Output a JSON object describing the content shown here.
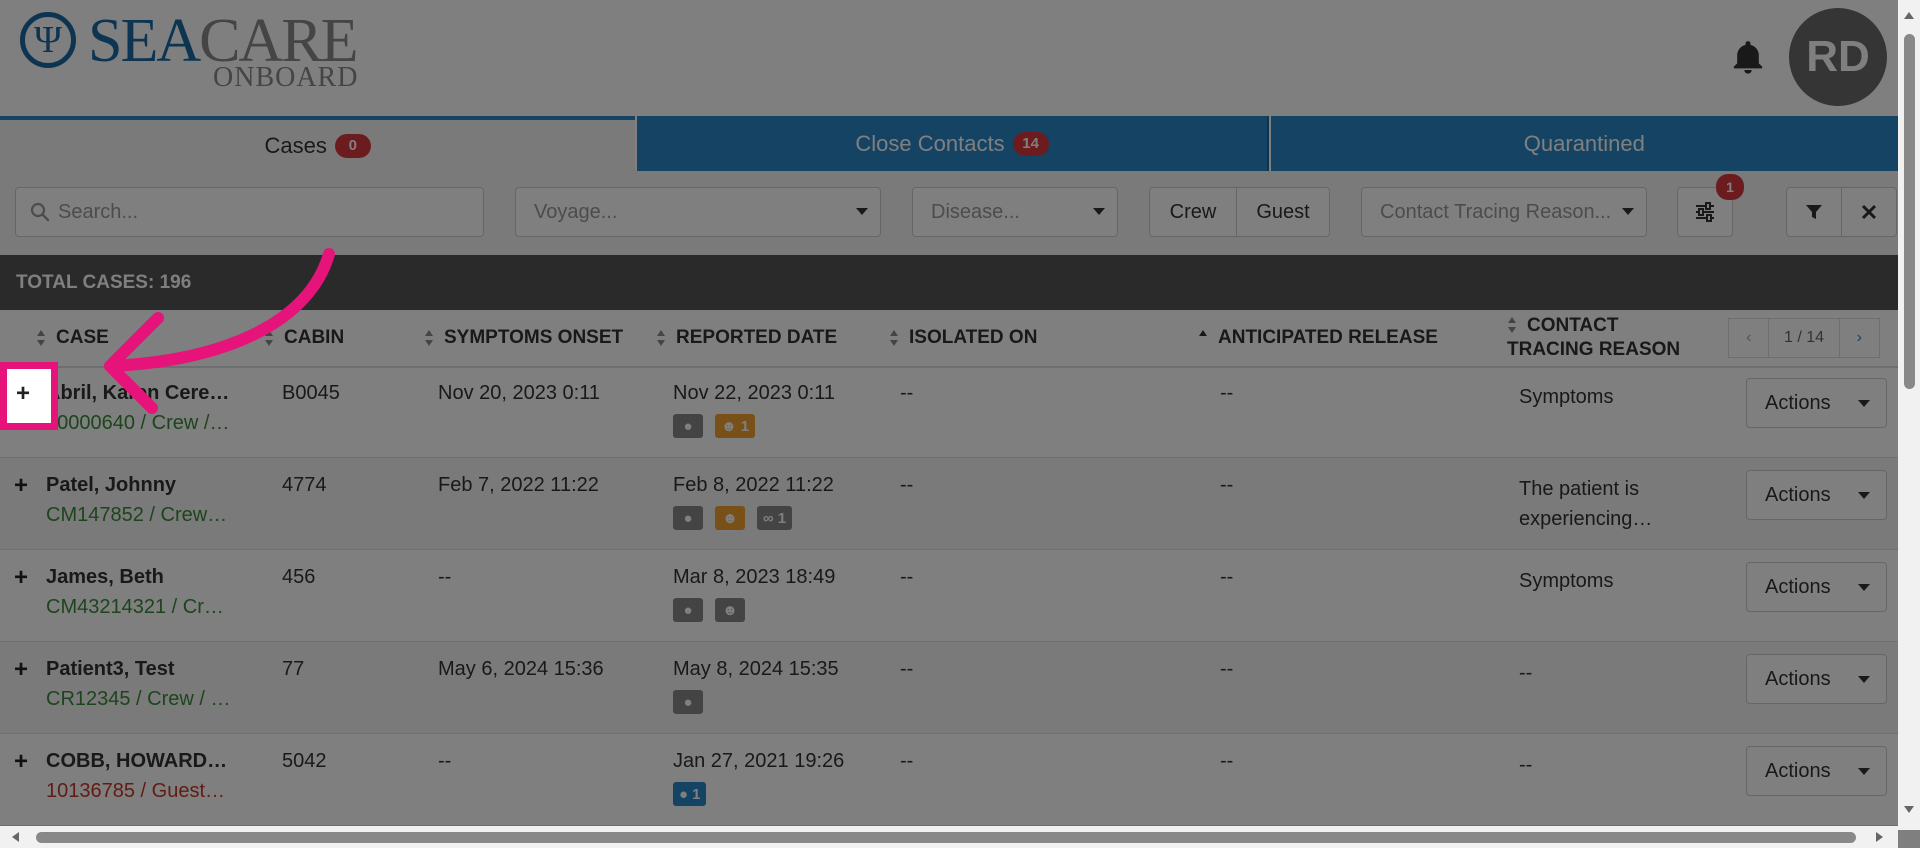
{
  "header": {
    "logo_main_1": "SEA",
    "logo_main_2": "CARE",
    "logo_sub": "ONBOARD",
    "avatar_initials": "RD"
  },
  "tabs": [
    {
      "label": "Cases",
      "count": "0",
      "active": true
    },
    {
      "label": "Close Contacts",
      "count": "14",
      "active": false
    },
    {
      "label": "Quarantined",
      "count": "",
      "active": false
    }
  ],
  "filters": {
    "search_placeholder": "Search...",
    "voyage_placeholder": "Voyage...",
    "disease_placeholder": "Disease...",
    "crew_label": "Crew",
    "guest_label": "Guest",
    "contact_reason_placeholder": "Contact Tracing Reason...",
    "settings_badge": "1"
  },
  "summary": {
    "total_label": "TOTAL CASES: 196"
  },
  "table": {
    "columns": [
      "CASE",
      "CABIN",
      "SYMPTOMS ONSET",
      "REPORTED DATE",
      "ISOLATED ON",
      "ANTICIPATED RELEASE",
      "CONTACT",
      "TRACING REASON"
    ],
    "pager": {
      "prev": "‹",
      "page": "1 / 14",
      "next": "›"
    },
    "actions_label": "Actions",
    "rows": [
      {
        "name": "Abril, Karen Cere…",
        "sub": "10000640 / Crew /…",
        "type": "crew",
        "cabin": "B0045",
        "onset": "Nov 20, 2023 0:11",
        "reported": "Nov 22, 2023 0:11",
        "isolated": "--",
        "release": "--",
        "reason": "Symptoms",
        "reason2": ""
      },
      {
        "name": "Patel, Johnny",
        "sub": "CM147852 / Crew…",
        "type": "crew",
        "cabin": "4774",
        "onset": "Feb 7, 2022 11:22",
        "reported": "Feb 8, 2022 11:22",
        "isolated": "--",
        "release": "--",
        "reason": "The patient is",
        "reason2": "experiencing…"
      },
      {
        "name": "James, Beth",
        "sub": "CM43214321 / Cr…",
        "type": "crew",
        "cabin": "456",
        "onset": "--",
        "reported": "Mar 8, 2023 18:49",
        "isolated": "--",
        "release": "--",
        "reason": "Symptoms",
        "reason2": ""
      },
      {
        "name": "Patient3, Test",
        "sub": "CR12345 / Crew / …",
        "type": "crew",
        "cabin": "77",
        "onset": "May 6, 2024 15:36",
        "reported": "May 8, 2024 15:35",
        "isolated": "--",
        "release": "--",
        "reason": "--",
        "reason2": ""
      },
      {
        "name": "COBB, HOWARD…",
        "sub": "10136785 / Guest…",
        "type": "guest",
        "cabin": "5042",
        "onset": "--",
        "reported": "Jan 27, 2021 19:26",
        "isolated": "--",
        "release": "--",
        "reason": "--",
        "reason2": ""
      }
    ],
    "chip_counts": {
      "row1_contacts": "1",
      "row2_attach": "1",
      "row5_location": "1"
    }
  },
  "colors": {
    "brand_blue": "#2b87c8",
    "badge_red": "#d9363e",
    "highlight_pink": "#e6137a",
    "crew_green": "#3a8a3a",
    "guest_red": "#c0392b"
  }
}
